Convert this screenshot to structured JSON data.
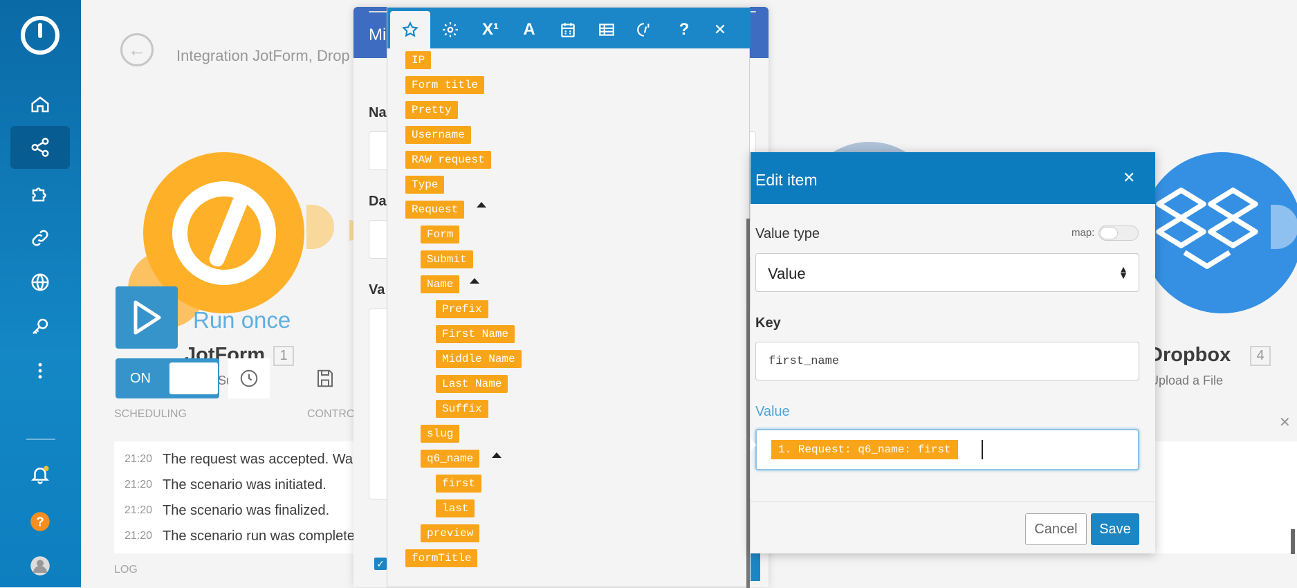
{
  "scenario": {
    "breadcrumb": "Integration JotForm, Drop",
    "run_label": "Run once",
    "module_name": "JotForm",
    "module_number": "1",
    "module_sub": "Su   ons",
    "toggle_on": "ON",
    "scheduling_label": "SCHEDULING",
    "controls_label": "CONTRO",
    "log_label": "LOG",
    "log_entries": [
      {
        "time": "21:20",
        "text": "The request was accepted. Wa"
      },
      {
        "time": "21:20",
        "text": "The scenario was initiated."
      },
      {
        "time": "21:20",
        "text": "The scenario was finalized."
      },
      {
        "time": "21:20",
        "text": "The scenario run was complete"
      }
    ],
    "dropbox_name": "Dropbox",
    "dropbox_number": "4",
    "dropbox_sub": "Upload a File"
  },
  "map_dialog": {
    "title": "Mi",
    "label_name": "Na",
    "label_data": "Da",
    "label_value": "Va"
  },
  "palette": {
    "tab_superscript": "X¹",
    "tab_text": "A",
    "tab_help": "?",
    "tab_close": "✕",
    "items": {
      "ip": "IP",
      "form_title": "Form title",
      "pretty": "Pretty",
      "username": "Username",
      "raw_request": "RAW request",
      "type": "Type",
      "request": "Request",
      "form": "Form",
      "submit": "Submit",
      "name": "Name",
      "prefix": "Prefix",
      "first_name": "First Name",
      "middle_name": "Middle Name",
      "last_name": "Last Name",
      "suffix": "Suffix",
      "slug": "slug",
      "q6_name": "q6_name",
      "first": "first",
      "last": "last",
      "preview": "preview",
      "form_title_key": "formTitle"
    }
  },
  "edit_item": {
    "title": "Edit item",
    "close": "✕",
    "value_type_label": "Value type",
    "map_label": "map:",
    "value_type_selected": "Value",
    "key_label": "Key",
    "key_value": "first_name",
    "value_label": "Value",
    "value_pill": "1. Request: q6_name: first",
    "cancel": "Cancel",
    "save": "Save"
  },
  "colors": {
    "accent": "#1c86c4",
    "pill": "#f9a51a",
    "jotform": "#fea60b",
    "dropbox": "#1a81e0"
  }
}
